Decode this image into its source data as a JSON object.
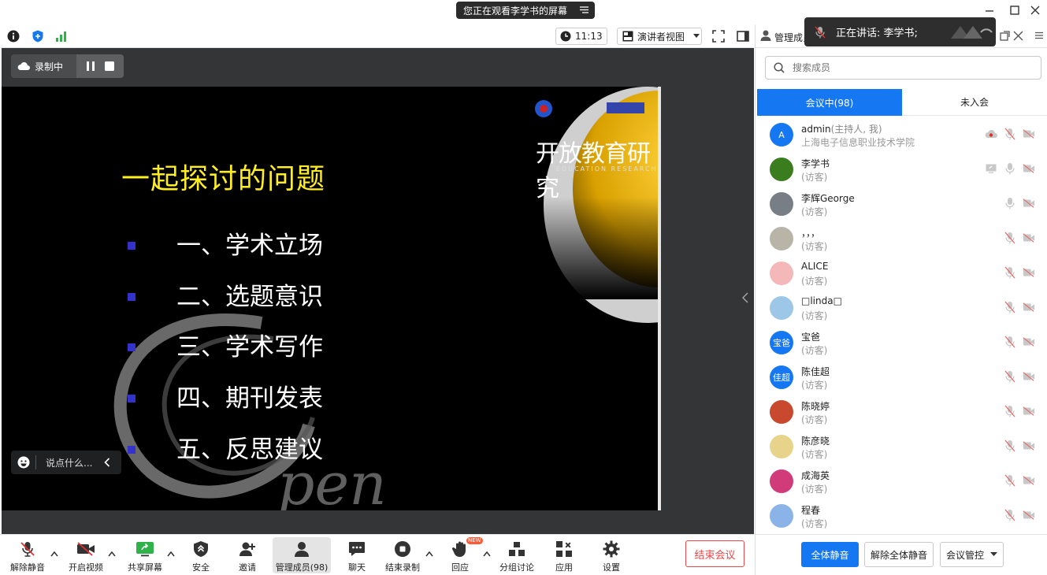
{
  "window": {
    "share_banner": "您正在观看李学书的屏幕"
  },
  "infobar": {
    "timer": "11:13",
    "view_mode": "演讲者视图"
  },
  "recording": {
    "label": "录制中"
  },
  "chat": {
    "placeholder": "说点什么..."
  },
  "slide": {
    "title": "一起探讨的问题",
    "items": [
      "一、学术立场",
      "二、选题意识",
      "三、学术写作",
      "四、期刊发表",
      "五、反思建议"
    ],
    "journal_title": "开放教育研究",
    "journal_sub": "EDUCATION RESEARCH"
  },
  "toolbar": {
    "unmute": "解除静音",
    "start_video": "开启视频",
    "share_screen": "共享屏幕",
    "security": "安全",
    "invite": "邀请",
    "manage_members": "管理成员(98)",
    "chat": "聊天",
    "stop_recording": "结束录制",
    "reactions": "回应",
    "new_badge": "NEW",
    "breakout": "分组讨论",
    "apps": "应用",
    "settings": "设置",
    "end_meeting": "结束会议"
  },
  "speaker_toast": {
    "text": "正在讲话: 李学书;"
  },
  "panel": {
    "title": "管理成员",
    "search_placeholder": "搜索成员",
    "tab_in_meeting": "会议中(98)",
    "tab_not_joined": "未入会",
    "members": [
      {
        "name": "admin",
        "role": "(主持人, 我)",
        "sub": "上海电子信息职业技术学院",
        "avatar": "A",
        "avatar_color": "#1677f3"
      },
      {
        "name": "李学书",
        "role": "",
        "sub": "(访客)",
        "avatar": "",
        "avatar_color": "#3a7d1e"
      },
      {
        "name": "李辉George",
        "role": "",
        "sub": "(访客)",
        "avatar": "",
        "avatar_color": "#777e86"
      },
      {
        "name": "，，，",
        "role": "",
        "sub": "(访客)",
        "avatar": "",
        "avatar_color": "#b9b4a8"
      },
      {
        "name": "ALICE",
        "role": "",
        "sub": "(访客)",
        "avatar": "",
        "avatar_color": "#f4b8b8"
      },
      {
        "name": "□linda□",
        "role": "",
        "sub": "(访客)",
        "avatar": "",
        "avatar_color": "#9cc7e6"
      },
      {
        "name": "宝爸",
        "role": "",
        "sub": "(访客)",
        "avatar": "宝爸",
        "avatar_color": "#1677f3"
      },
      {
        "name": "陈佳超",
        "role": "",
        "sub": "(访客)",
        "avatar": "佳超",
        "avatar_color": "#1677f3"
      },
      {
        "name": "陈晓婷",
        "role": "",
        "sub": "(访客)",
        "avatar": "",
        "avatar_color": "#c8492e"
      },
      {
        "name": "陈彦晓",
        "role": "",
        "sub": "(访客)",
        "avatar": "",
        "avatar_color": "#e7d38a"
      },
      {
        "name": "成海英",
        "role": "",
        "sub": "(访客)",
        "avatar": "",
        "avatar_color": "#d23b7a"
      },
      {
        "name": "程春",
        "role": "",
        "sub": "(访客)",
        "avatar": "",
        "avatar_color": "#8ab4e8"
      }
    ],
    "mute_all": "全体静音",
    "unmute_all": "解除全体静音",
    "meeting_control": "会议管控"
  }
}
